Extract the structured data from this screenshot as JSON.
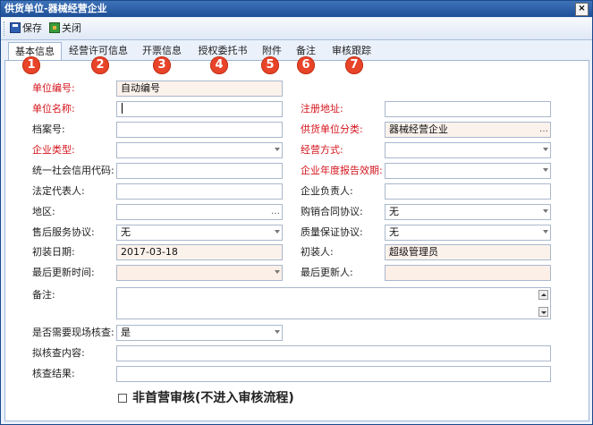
{
  "window": {
    "title": "供货单位-器械经营企业",
    "close_glyph": "×"
  },
  "toolbar": {
    "save_label": "保存",
    "close_label": "关闭"
  },
  "tabs": [
    {
      "label": "基本信息",
      "badge": "1"
    },
    {
      "label": "经营许可信息",
      "badge": "2"
    },
    {
      "label": "开票信息",
      "badge": "3"
    },
    {
      "label": "授权委托书",
      "badge": "4"
    },
    {
      "label": "附件",
      "badge": "5"
    },
    {
      "label": "备注",
      "badge": "6"
    },
    {
      "label": "审核跟踪",
      "badge": "7"
    }
  ],
  "form": {
    "unit_code": {
      "label": "单位编号:",
      "value": "自动编号"
    },
    "unit_name": {
      "label": "单位名称:",
      "value": ""
    },
    "reg_address": {
      "label": "注册地址:",
      "value": ""
    },
    "file_no": {
      "label": "档案号:",
      "value": ""
    },
    "supplier_category": {
      "label": "供货单位分类:",
      "value": "器械经营企业"
    },
    "enterprise_type": {
      "label": "企业类型:",
      "value": ""
    },
    "business_mode": {
      "label": "经营方式:",
      "value": ""
    },
    "credit_code": {
      "label": "统一社会信用代码:",
      "value": ""
    },
    "annual_report": {
      "label": "企业年度报告效期:",
      "value": ""
    },
    "legal_rep": {
      "label": "法定代表人:",
      "value": ""
    },
    "enterprise_head": {
      "label": "企业负责人:",
      "value": ""
    },
    "region": {
      "label": "地区:",
      "value": ""
    },
    "purchase_agreement": {
      "label": "购销合同协议:",
      "value": "无"
    },
    "after_sales": {
      "label": "售后服务协议:",
      "value": "无"
    },
    "quality_agreement": {
      "label": "质量保证协议:",
      "value": "无"
    },
    "entry_date": {
      "label": "初装日期:",
      "value": "2017-03-18"
    },
    "entry_person": {
      "label": "初装人:",
      "value": "超级管理员"
    },
    "last_update_time": {
      "label": "最后更新时间:",
      "value": ""
    },
    "last_updater": {
      "label": "最后更新人:",
      "value": ""
    },
    "remarks": {
      "label": "备注:",
      "value": ""
    },
    "onsite_check": {
      "label": "是否需要现场核查:",
      "value": "是"
    },
    "check_content": {
      "label": "拟核查内容:",
      "value": ""
    },
    "check_result": {
      "label": "核查结果:",
      "value": ""
    },
    "non_first_checkbox": {
      "label": "非首营审核(不进入审核流程)",
      "checked": false
    }
  },
  "colors": {
    "required_label": "#d4141c",
    "badge": "#e8442a",
    "title_bar": "#1d4f98"
  }
}
